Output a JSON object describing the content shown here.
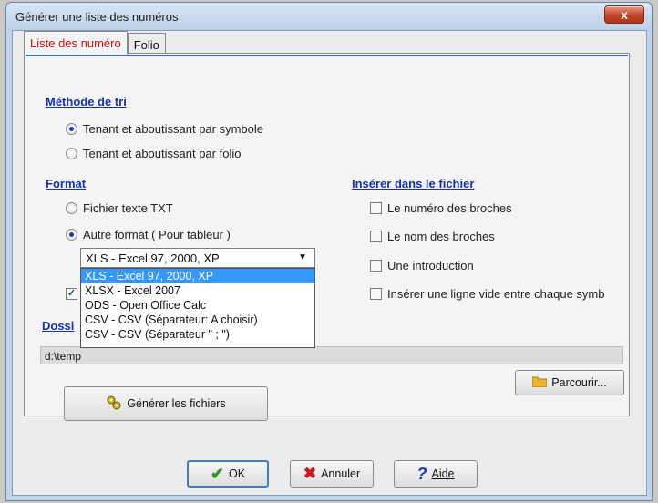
{
  "window": {
    "title": "Générer une liste des numéros",
    "close_label": "x"
  },
  "tabs": [
    {
      "label": "Liste des numéro"
    },
    {
      "label": "Folio"
    }
  ],
  "sort": {
    "heading": "Méthode de tri",
    "options": [
      {
        "label": "Tenant et aboutissant par symbole",
        "selected": true
      },
      {
        "label": "Tenant et aboutissant par folio",
        "selected": false
      }
    ]
  },
  "format": {
    "heading": "Format",
    "options": [
      {
        "label": "Fichier texte TXT",
        "selected": false
      },
      {
        "label": "Autre format ( Pour tableur )",
        "selected": true
      }
    ],
    "select_value": "XLS - Excel 97, 2000, XP",
    "dropdown_options": [
      "XLS - Excel 97, 2000, XP",
      "XLSX - Excel 2007",
      "ODS - Open Office Calc",
      "CSV - CSV (Séparateur: A choisir)",
      "CSV - CSV (Séparateur \" ; \")"
    ]
  },
  "insert": {
    "heading": "Insérer dans le fichier",
    "options": [
      {
        "label": "Le numéro des broches",
        "checked": false
      },
      {
        "label": "Le nom des broches",
        "checked": false
      },
      {
        "label": "Une introduction",
        "checked": false
      },
      {
        "label": "Insérer une ligne vide entre chaque symb",
        "checked": false
      }
    ]
  },
  "folder": {
    "label": "Dossi",
    "path": "d:\\temp"
  },
  "hidden_checkbox": {
    "checked": true
  },
  "buttons": {
    "generate": "Générer les fichiers",
    "browse": "Parcourir...",
    "ok": "OK",
    "cancel": "Annuler",
    "help": "Aide"
  }
}
